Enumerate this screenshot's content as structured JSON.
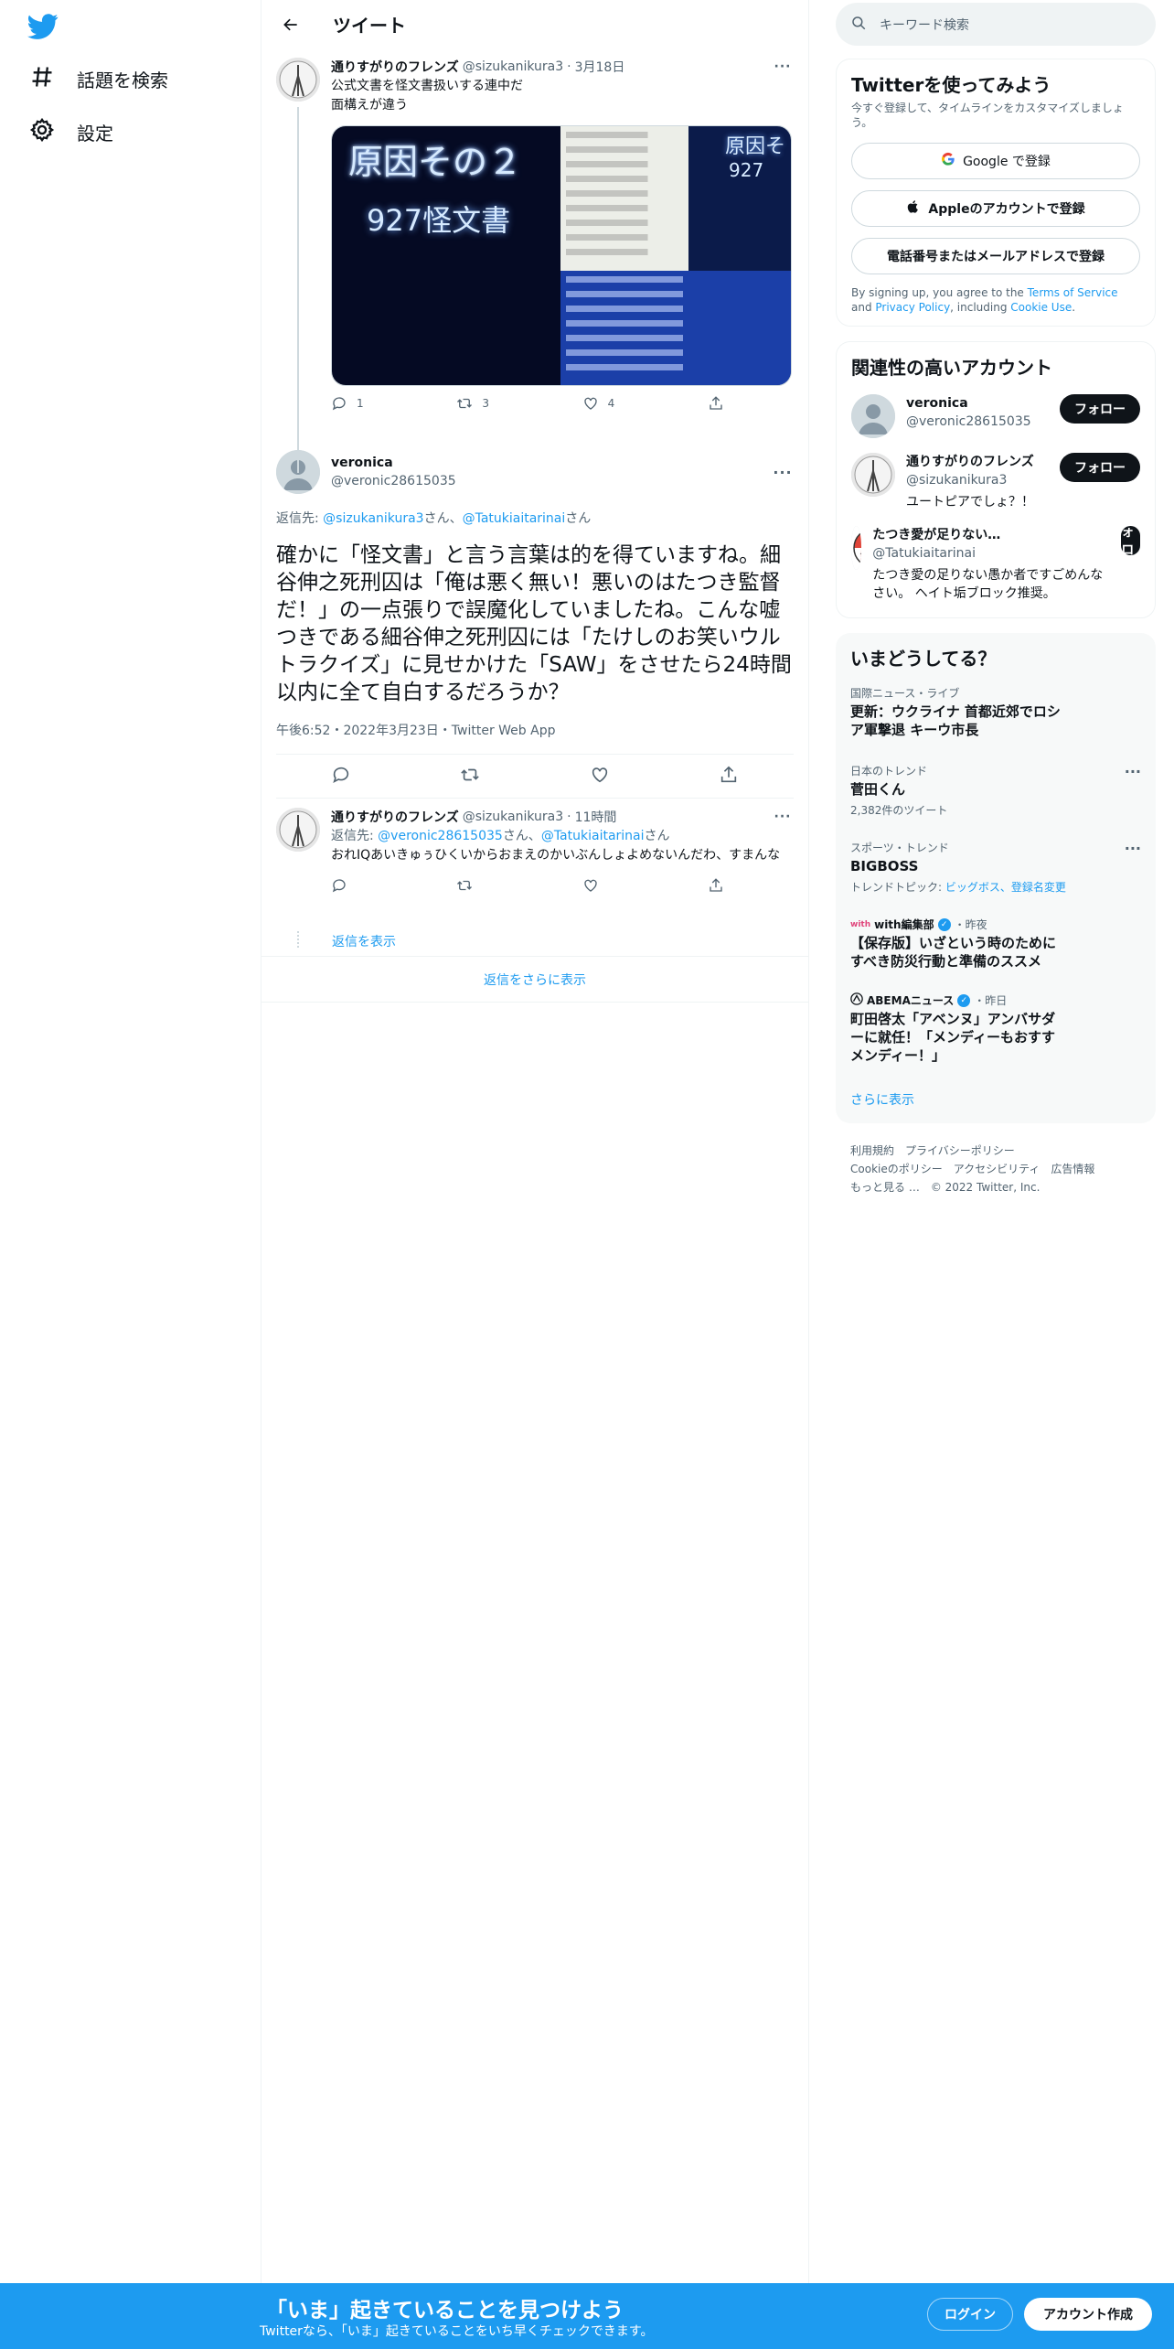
{
  "nav": {
    "explore_label": "話題を検索",
    "settings_label": "設定"
  },
  "header": {
    "title": "ツイート"
  },
  "tweet1": {
    "name": "通りすがりのフレンズ",
    "handle": "@sizukanikura3",
    "date": "3月18日",
    "line1": "公式文書を怪文書扱いする連中だ",
    "line2": "面構えが違う",
    "media_left_title": "原因その２",
    "media_left_sub": "927怪文書",
    "media_right_title": "原因そ",
    "media_right_sub": "927",
    "replies": "1",
    "retweets": "3",
    "likes": "4"
  },
  "focal": {
    "name": "veronica",
    "handle": "@veronic28615035",
    "reply_prefix": "返信先: ",
    "reply_user1": "@sizukanikura3",
    "reply_sep": "さん、",
    "reply_user2": "@Tatukiaitarinai",
    "reply_suffix": "さん",
    "text": "確かに「怪文書」と言う言葉は的を得ていますね。細谷伸之死刑囚は「俺は悪く無い！悪いのはたつき監督だ！」の一点張りで誤魔化していましたね。こんな嘘つきである細谷伸之死刑囚には「たけしのお笑いウルトラクイズ」に見せかけた「SAW」をさせたら24時間以内に全て自白するだろうか？",
    "meta": "午後6:52・2022年3月23日・Twitter Web App"
  },
  "reply": {
    "name": "通りすがりのフレンズ",
    "handle": "@sizukanikura3",
    "time": "11時間",
    "reply_prefix": "返信先: ",
    "reply_user1": "@veronic28615035",
    "reply_sep": "さん、",
    "reply_user2": "@Tatukiaitarinai",
    "reply_suffix": "さん",
    "text": "おれIQあいきゅぅひくいからおまえのかいぶんしょよめないんだわ、すまんな",
    "show_replies": "返信を表示"
  },
  "show_more": "返信をさらに表示",
  "right": {
    "search_placeholder": "キーワード検索",
    "signup_title": "Twitterを使ってみよう",
    "signup_sub": "今すぐ登録して、タイムラインをカスタマイズしましょう。",
    "google_btn": "Google で登録",
    "apple_btn": "Appleのアカウントで登録",
    "phone_btn": "電話番号またはメールアドレスで登録",
    "terms_1": "By signing up, you agree to the ",
    "terms_link1": "Terms of Service",
    "terms_2": " and ",
    "terms_link2": "Privacy Policy",
    "terms_3": ", including ",
    "terms_link3": "Cookie Use",
    "terms_4": ".",
    "related_title": "関連性の高いアカウント",
    "follow_label": "フォロー",
    "accounts": [
      {
        "name": "veronica",
        "handle": "@veronic28615035",
        "bio": ""
      },
      {
        "name": "通りすがりのフレンズ",
        "handle": "@sizukanikura3",
        "bio": "ユートピアでしょ？！"
      },
      {
        "name": "たつき愛が足りない…",
        "handle": "@Tatukiaitarinai",
        "bio": "たつき愛の足りない愚か者ですごめんなさい。 ヘイト垢ブロック推奨。"
      }
    ],
    "trends_title": "いまどうしてる？",
    "trends": [
      {
        "cat": "国際ニュース・ライブ",
        "title": "更新：ウクライナ 首都近郊でロシア軍撃退 キーウ市長",
        "count": ""
      },
      {
        "cat": "日本のトレンド",
        "title": "菅田くん",
        "count": "2,382件のツイート"
      },
      {
        "cat": "スポーツ・トレンド",
        "title": "BIGBOSS",
        "count_prefix": "トレンドトピック: ",
        "count_links": "ビッグボス、登録名変更"
      }
    ],
    "news": [
      {
        "source": "with編集部",
        "time": "・昨夜",
        "title": "【保存版】いざという時のためにすべき防災行動と準備のススメ"
      },
      {
        "source": "ABEMAニュース",
        "time": "・昨日",
        "title": "町田啓太「アベンヌ」アンバサダーに就任！「メンディーもおすすメンディー！」"
      }
    ],
    "show_more": "さらに表示",
    "footer": {
      "terms": "利用規約",
      "privacy": "プライバシーポリシー",
      "cookie": "Cookieのポリシー",
      "access": "アクセシビリティ",
      "ads": "広告情報",
      "more": "もっと見る …",
      "copy": "© 2022 Twitter, Inc."
    }
  },
  "bottom": {
    "title": "「いま」起きていることを見つけよう",
    "sub": "Twitterなら、「いま」起きていることをいち早くチェックできます。",
    "login": "ログイン",
    "signup": "アカウント作成"
  },
  "colors": {
    "accent": "#1d9bf0",
    "text": "#0f1419",
    "muted": "#536471"
  }
}
